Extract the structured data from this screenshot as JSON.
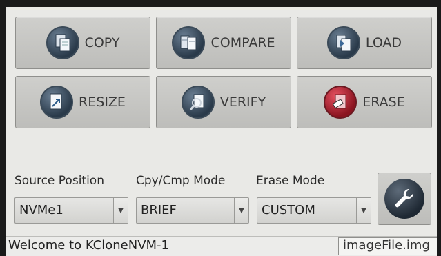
{
  "actions": {
    "copy": "COPY",
    "compare": "COMPARE",
    "load": "LOAD",
    "resize": "RESIZE",
    "verify": "VERIFY",
    "erase": "ERASE"
  },
  "fields": {
    "source_position": {
      "label": "Source Position",
      "value": "NVMe1"
    },
    "cpy_cmp_mode": {
      "label": "Cpy/Cmp Mode",
      "value": "BRIEF"
    },
    "erase_mode": {
      "label": "Erase Mode",
      "value": "CUSTOM"
    }
  },
  "status": {
    "message": "Welcome to KCloneNVM-1",
    "file": "imageFile.img"
  },
  "icons": {
    "copy": "copy-icon",
    "compare": "compare-icon",
    "load": "load-icon",
    "resize": "resize-icon",
    "verify": "verify-icon",
    "erase": "erase-icon",
    "settings": "wrench-icon",
    "dropdown": "chevron-down-icon"
  },
  "colors": {
    "screen_bg": "#e9e9e6",
    "button_bg": "#c6c6c3",
    "erase_accent": "#c62a3a",
    "icon_bg": "#3b4a58"
  }
}
